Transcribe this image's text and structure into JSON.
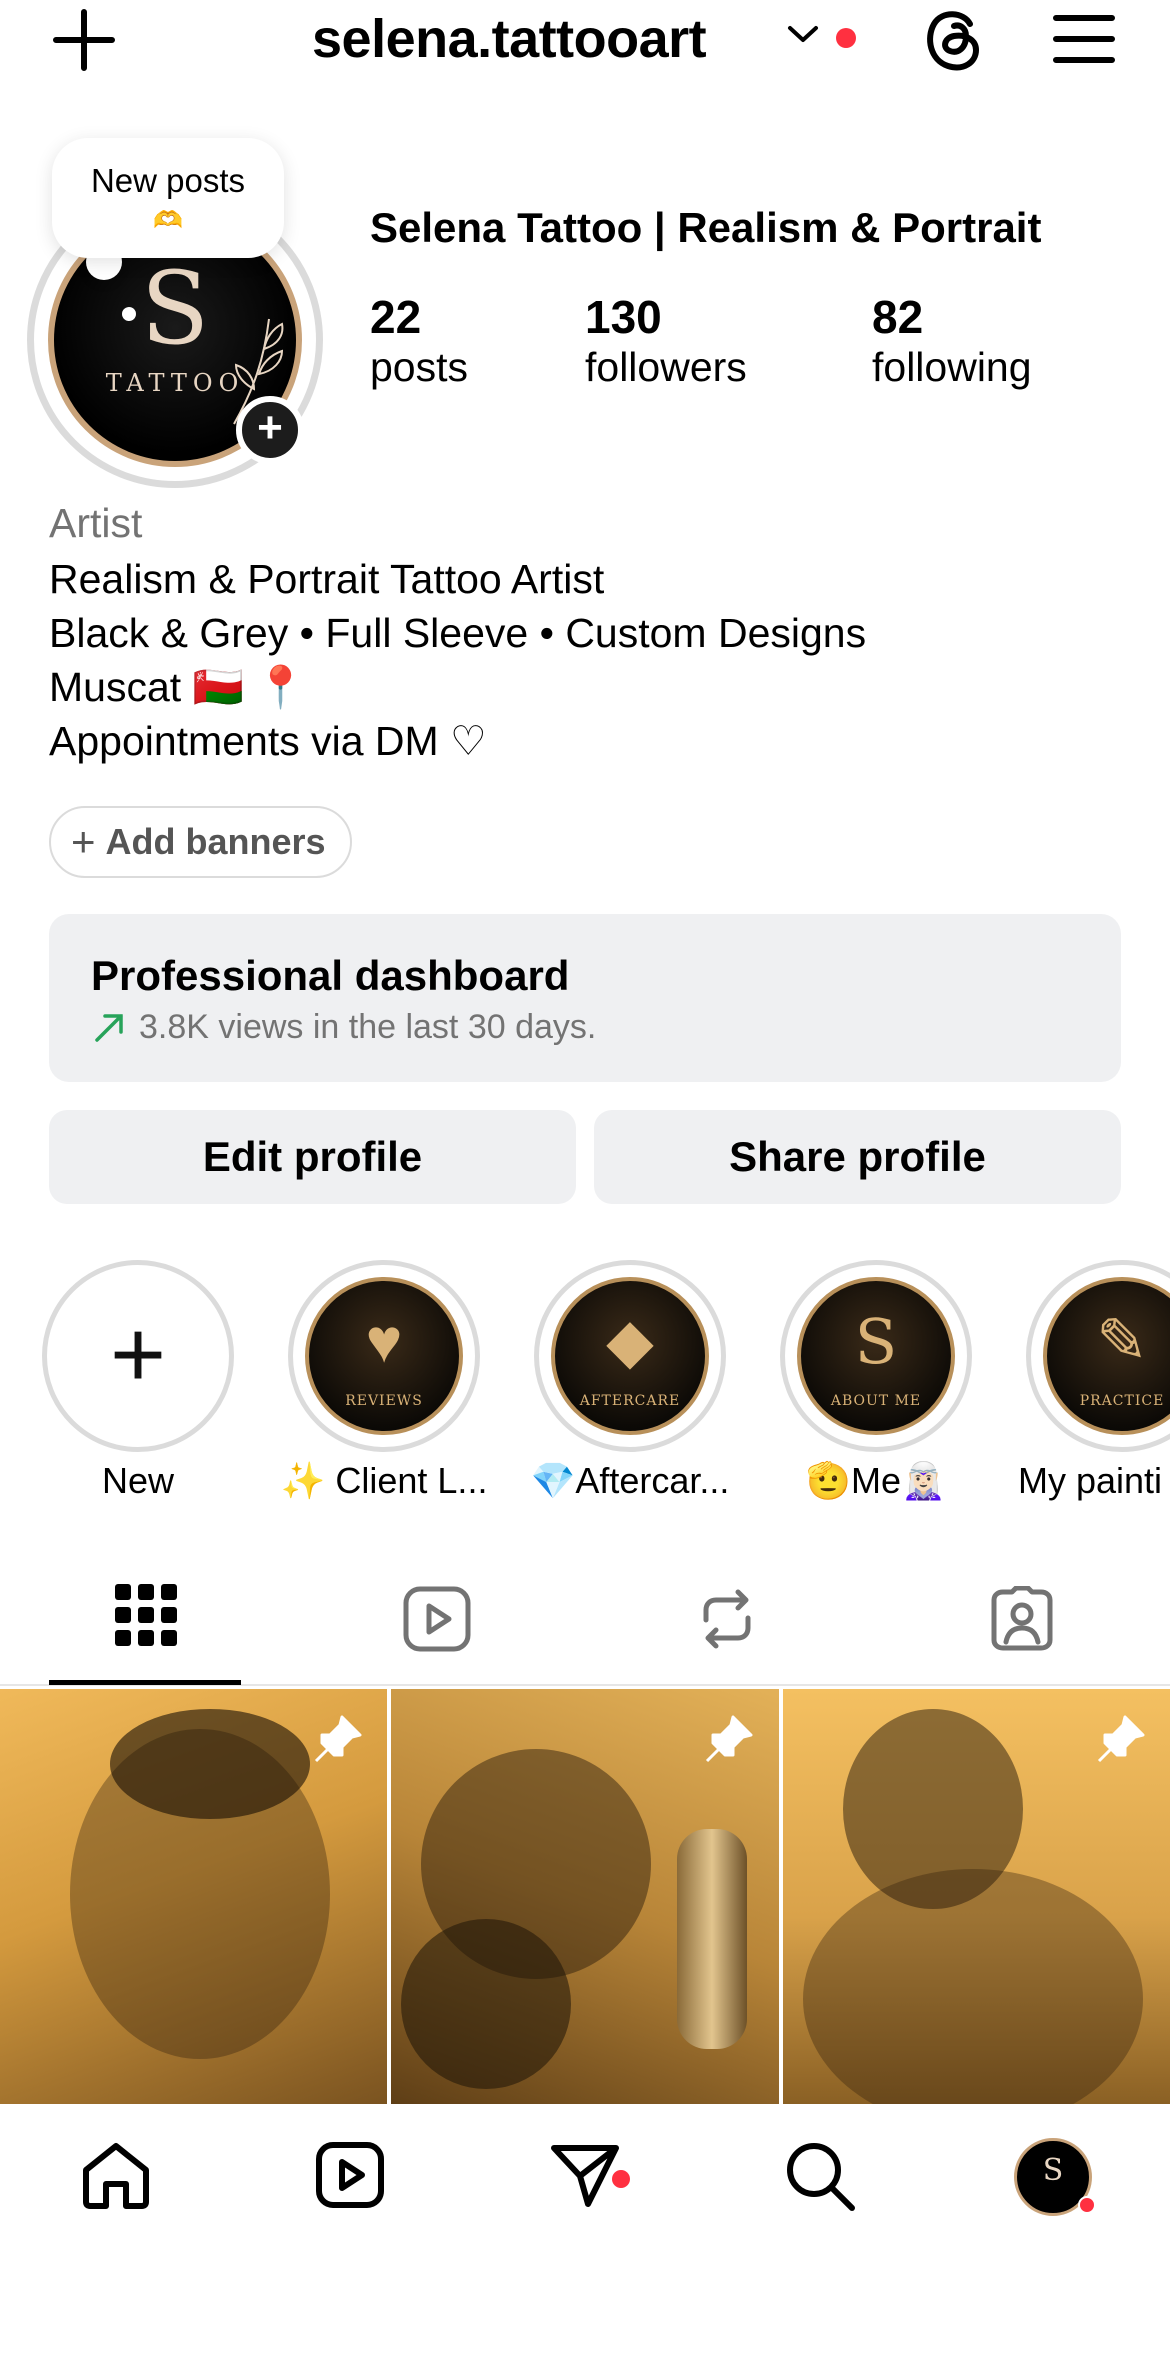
{
  "header": {
    "username": "selena.tattooart"
  },
  "avatar": {
    "monogram": "S",
    "wordmark": "TATTOO"
  },
  "bubble": {
    "title": "New posts",
    "emoji": "🫶"
  },
  "profile": {
    "display_name": "Selena Tattoo | Realism & Portrait",
    "stats": [
      {
        "value": "22",
        "label": "posts"
      },
      {
        "value": "130",
        "label": "followers"
      },
      {
        "value": "82",
        "label": "following"
      }
    ],
    "category": "Artist",
    "bio_lines": [
      "Realism & Portrait Tattoo Artist",
      "Black & Grey • Full Sleeve • Custom Designs",
      "Muscat 🇴🇲 📍",
      "Appointments via DM ♡"
    ]
  },
  "banners": {
    "label": "Add banners"
  },
  "dashboard": {
    "title": "Professional dashboard",
    "subtitle": "3.8K views in the last 30 days."
  },
  "buttons": {
    "edit": "Edit profile",
    "share": "Share profile"
  },
  "highlights": [
    {
      "label": "New"
    },
    {
      "label": "✨ Client L...",
      "badge": "REVIEWS"
    },
    {
      "label": "💎Aftercar...",
      "badge": "AFTERCARE"
    },
    {
      "label": "🫡Me🧝🏻‍♀️",
      "badge": "ABOUT ME"
    },
    {
      "label": "My painti",
      "badge": "PRACTICE"
    }
  ],
  "tabs": [
    "grid-icon",
    "reels-icon",
    "reposts-icon",
    "tagged-icon"
  ],
  "colors": {
    "notification_red": "#ff3040",
    "trend_green": "#27a35a",
    "gold": "#c9a37a"
  }
}
